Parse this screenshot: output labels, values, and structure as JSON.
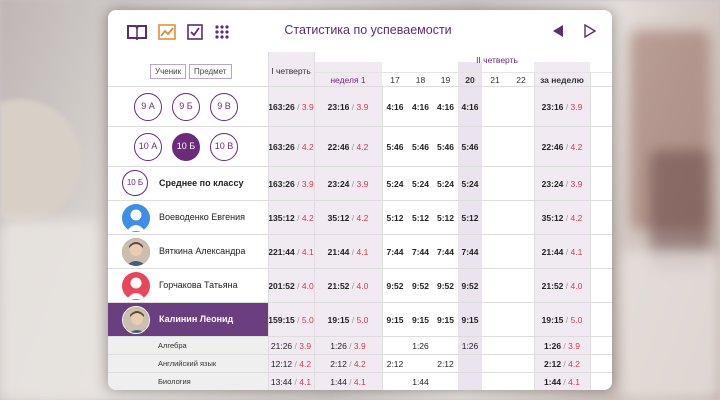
{
  "title": "Статистика по успеваемости",
  "toolbar": {
    "icons": [
      "book-icon",
      "chart-icon",
      "checkbox-icon",
      "grid-icon"
    ],
    "prev_icon": "triangle-left-icon",
    "next_icon": "triangle-right-icon"
  },
  "filters": {
    "student": "Ученик",
    "subject": "Предмет"
  },
  "headers": {
    "quarter1": "I четверть",
    "quarter2": "II четверть",
    "week": "неделя 1",
    "days": [
      "17",
      "18",
      "19",
      "20",
      "21",
      "22"
    ],
    "per_week": "за неделю"
  },
  "classes_row1": [
    "9 А",
    "9 Б",
    "9 В"
  ],
  "classes_row2": [
    "10 А",
    "10 Б",
    "10 В"
  ],
  "rows": [
    {
      "q": [
        "163:26",
        "3.9"
      ],
      "w": [
        "23:16",
        "3.9"
      ],
      "d": [
        "4:16",
        "4:16",
        "4:16",
        "4:16",
        "",
        ""
      ],
      "t": [
        "23:16",
        "3.9"
      ]
    },
    {
      "q": [
        "163:26",
        "4.2"
      ],
      "w": [
        "22:46",
        "4.2"
      ],
      "d": [
        "5:46",
        "5:46",
        "5:46",
        "5:46",
        "",
        ""
      ],
      "t": [
        "22:46",
        "4.2"
      ]
    },
    {
      "label_circle": "10 Б",
      "name": "Среднее по классу",
      "q": [
        "163:26",
        "3.9"
      ],
      "w": [
        "23:24",
        "3.9"
      ],
      "d": [
        "5:24",
        "5:24",
        "5:24",
        "5:24",
        "",
        ""
      ],
      "t": [
        "23:24",
        "3.9"
      ]
    },
    {
      "name": "Воеводенко Евгения",
      "q": [
        "135:12",
        "4.2"
      ],
      "w": [
        "35:12",
        "4.2"
      ],
      "d": [
        "5:12",
        "5:12",
        "5:12",
        "5:12",
        "",
        ""
      ],
      "t": [
        "35:12",
        "4.2"
      ]
    },
    {
      "name": "Вяткина Александра",
      "q": [
        "221:44",
        "4.1"
      ],
      "w": [
        "21:44",
        "4.1"
      ],
      "d": [
        "7:44",
        "7:44",
        "7:44",
        "7:44",
        "",
        ""
      ],
      "t": [
        "21:44",
        "4.1"
      ]
    },
    {
      "name": "Горчакова Татьяна",
      "q": [
        "201:52",
        "4.0"
      ],
      "w": [
        "21:52",
        "4.0"
      ],
      "d": [
        "9:52",
        "9:52",
        "9:52",
        "9:52",
        "",
        ""
      ],
      "t": [
        "21:52",
        "4.0"
      ]
    },
    {
      "name": "Калинин Леонид",
      "q": [
        "159:15",
        "5.0"
      ],
      "w": [
        "19:15",
        "5.0"
      ],
      "d": [
        "9:15",
        "9:15",
        "9:15",
        "9:15",
        "",
        ""
      ],
      "t": [
        "19:15",
        "5.0"
      ]
    }
  ],
  "subjects": [
    {
      "name": "Алгебра",
      "q": [
        "21:26",
        "3.9"
      ],
      "w": [
        "1:26",
        "3.9"
      ],
      "d": [
        "",
        "1:26",
        "",
        "1:26",
        "",
        ""
      ],
      "t": [
        "1:26",
        "3.9"
      ]
    },
    {
      "name": "Английский язык",
      "q": [
        "12:12",
        "4.2"
      ],
      "w": [
        "2:12",
        "4.2"
      ],
      "d": [
        "2:12",
        "",
        "2:12",
        "",
        "",
        ""
      ],
      "t": [
        "2:12",
        "4.2"
      ]
    },
    {
      "name": "Биология",
      "q": [
        "13:44",
        "4.1"
      ],
      "w": [
        "1:44",
        "4.1"
      ],
      "d": [
        "",
        "1:44",
        "",
        "",
        "",
        ""
      ],
      "t": [
        "1:44",
        "4.1"
      ]
    }
  ],
  "colors": {
    "accent": "#6b2a7a",
    "grade": "#d13b4a",
    "selected_row": "#6b3e7f"
  }
}
